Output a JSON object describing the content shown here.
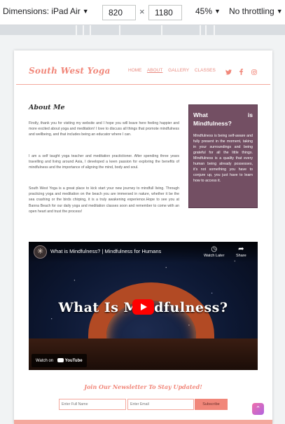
{
  "devtools": {
    "dimensions_label": "Dimensions: iPad Air",
    "width": "820",
    "times": "×",
    "height": "1180",
    "zoom": "45%",
    "throttling": "No throttling"
  },
  "site": {
    "logo": "South West Yoga",
    "nav": [
      "HOME",
      "ABOUT",
      "GALLERY",
      "CLASSES"
    ],
    "active_nav": "ABOUT",
    "social_icons": [
      "twitter-icon",
      "facebook-icon",
      "instagram-icon"
    ],
    "accent_color": "#f1877a"
  },
  "about": {
    "heading": "About Me",
    "paragraphs": [
      "Firstly, thank you for visiting my website and I hope you will leave here feeling happier and more excited about yoga and meditation! I love to discuss all things that promote mindfulness and wellbeing, and that includes being an educator where I can.",
      "I am a self taught yoga teacher and meditation practictioner. After spending three years travelling and living around Asia, I developed a keen passion for exploring the benefits of mindfulness and the importance of aligning the mind, body and soul.",
      "South West Yoga is a great place to kick start your new journey to mindfull living. Through practicing yoga and meditation on the beach you are immersed in nature, whether it be the sea crashing or the birds chirping, it is a truly awakening experience.Hope to see you at Banna Beach for our daily yoga and meditation classes soon and remember to come with an open heart and trust the process!"
    ]
  },
  "mindfulness": {
    "title": "What is Mindfulness?",
    "text": "Mindfulness is being self-aware and fully present in the moment, taking in your surroundings and being grateful for all the little things. Mindfulness is a quality that every human being already possesses, it's not something you have to conjure up, you just have to learn how to access it."
  },
  "video": {
    "title": "What is Mindfulness? | Mindfulness for Humans",
    "overlay_title": "What Is Mindfulness?",
    "watch_later": "Watch Later",
    "share": "Share",
    "watch_on": "Watch on",
    "youtube": "YouTube"
  },
  "newsletter": {
    "heading": "Join Our Newsletter To Stay Updated!",
    "name_placeholder": "Enter Full Name",
    "email_placeholder": "Enter Email",
    "button": "Subscribe"
  }
}
